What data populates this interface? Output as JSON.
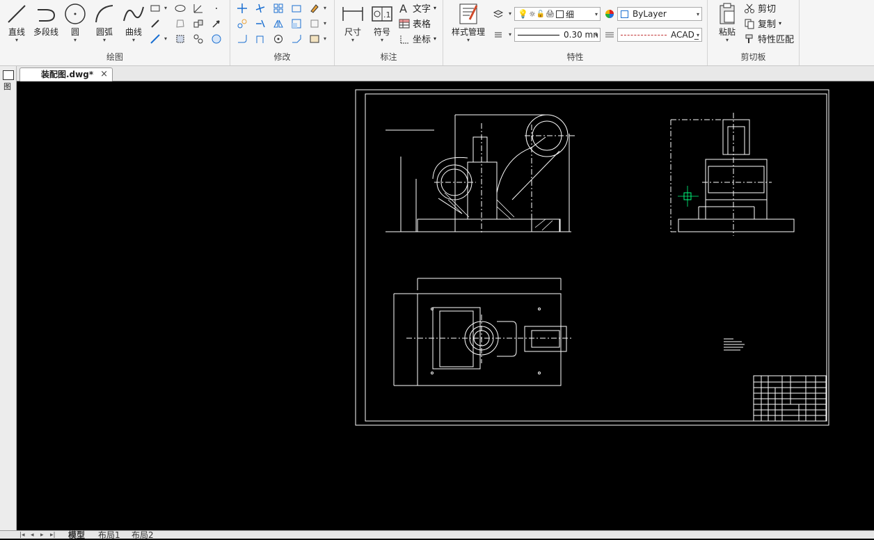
{
  "ribbon": {
    "draw": {
      "title": "绘图",
      "line": "直线",
      "polyline": "多段线",
      "circle": "圆",
      "arc": "圆弧",
      "curve": "曲线"
    },
    "modify": {
      "title": "修改"
    },
    "annotate": {
      "title": "标注",
      "dimension": "尺寸",
      "symbol": "符号",
      "text": "文字",
      "table": "表格",
      "coordinate": "坐标"
    },
    "properties": {
      "title": "特性",
      "style_manager": "样式管理",
      "layer_value": "细",
      "color_value": "ByLayer",
      "lineweight_value": "0.30 mn",
      "linetype_value": "ACAD_"
    },
    "clipboard": {
      "title": "剪切板",
      "paste": "粘贴",
      "cut": "剪切",
      "copy": "复制",
      "match": "特性匹配"
    }
  },
  "document": {
    "tab_label": "装配图.dwg*",
    "close": "×"
  },
  "left_strip": {
    "label": "图"
  },
  "layout_tabs": [
    "模型",
    "布局1",
    "布局2"
  ],
  "colors": {
    "ribbon_bg": "#f5f5f5",
    "canvas_bg": "#000000",
    "drawing_line": "#ffffff",
    "cursor": "#00ff7f",
    "accent_blue": "#1a6fd1"
  }
}
